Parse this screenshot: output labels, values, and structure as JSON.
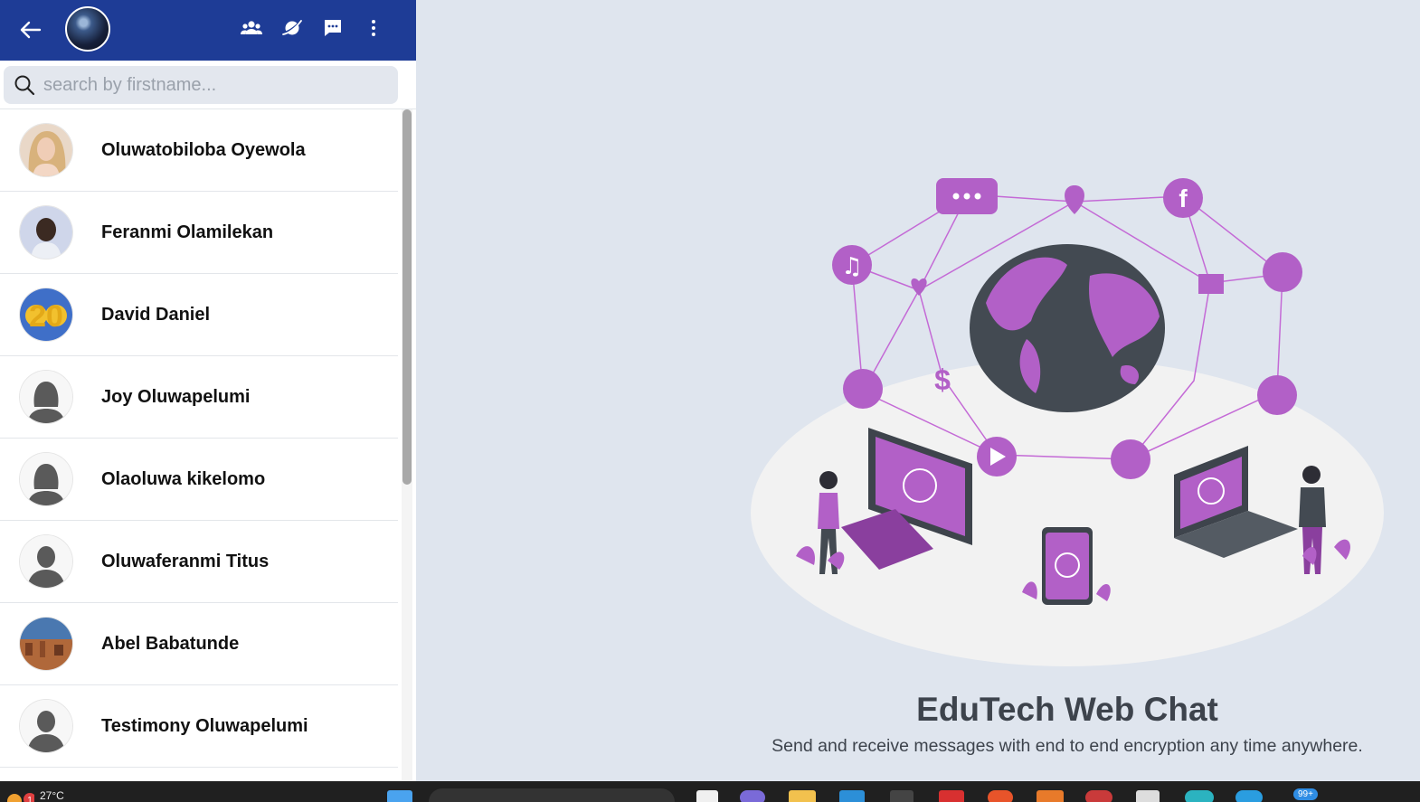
{
  "search": {
    "placeholder": "search by firstname..."
  },
  "contacts": [
    {
      "name": "Oluwatobiloba Oyewola",
      "avatar": "photo-blonde"
    },
    {
      "name": "Feranmi Olamilekan",
      "avatar": "photo-man"
    },
    {
      "name": "David Daniel",
      "avatar": "photo-balloons"
    },
    {
      "name": "Joy Oluwapelumi",
      "avatar": "default-female"
    },
    {
      "name": "Olaoluwa kikelomo",
      "avatar": "default-female"
    },
    {
      "name": "Oluwaferanmi Titus",
      "avatar": "default-male"
    },
    {
      "name": "Abel Babatunde",
      "avatar": "photo-city"
    },
    {
      "name": "Testimony Oluwapelumi",
      "avatar": "default-male"
    }
  ],
  "balloon_text": "20",
  "welcome": {
    "title": "EduTech Web Chat",
    "subtitle": "Send and receive messages with end to end encryption any time anywhere."
  },
  "taskbar": {
    "temperature": "27°C",
    "weather_badge": "1",
    "notifications_badge": "99+"
  },
  "colors": {
    "header": "#1e3c96",
    "accent_purple": "#b260c7",
    "background": "#dfe5ee"
  }
}
